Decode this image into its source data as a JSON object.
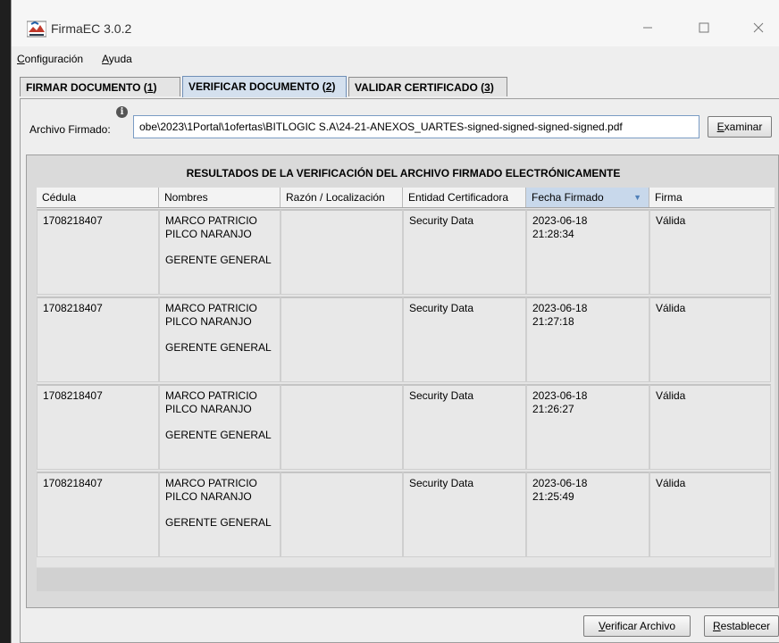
{
  "window": {
    "title": "FirmaEC 3.0.2"
  },
  "menu": {
    "configuracion_mnemonic": "C",
    "configuracion_rest": "onfiguración",
    "ayuda_mnemonic": "A",
    "ayuda_rest": "yuda"
  },
  "tabs": [
    {
      "label": "FIRMAR DOCUMENTO",
      "num": "1",
      "active": false
    },
    {
      "label": "VERIFICAR DOCUMENTO",
      "num": "2",
      "active": true
    },
    {
      "label": "VALIDAR CERTIFICADO",
      "num": "3",
      "active": false
    }
  ],
  "file": {
    "label": "Archivo Firmado:",
    "value": "obe\\2023\\1Portal\\1ofertas\\BITLOGIC S.A\\24-21-ANEXOS_UARTES-signed-signed-signed-signed.pdf",
    "browse_mnemonic": "E",
    "browse_rest": "xaminar"
  },
  "results": {
    "title": "RESULTADOS DE LA VERIFICACIÓN DEL ARCHIVO FIRMADO ELECTRÓNICAMENTE",
    "columns": [
      "Cédula",
      "Nombres",
      "Razón / Localización",
      "Entidad Certificadora",
      "Fecha Firmado",
      "Firma"
    ],
    "rows": [
      {
        "cedula": "1708218407",
        "nombre": "MARCO PATRICIO PILCO NARANJO",
        "cargo": "GERENTE GENERAL",
        "razon": "",
        "entidad": "Security Data",
        "fecha": "2023-06-18",
        "hora": "21:28:34",
        "firma": "Válida"
      },
      {
        "cedula": "1708218407",
        "nombre": "MARCO PATRICIO PILCO NARANJO",
        "cargo": "GERENTE GENERAL",
        "razon": "",
        "entidad": "Security Data",
        "fecha": "2023-06-18",
        "hora": "21:27:18",
        "firma": "Válida"
      },
      {
        "cedula": "1708218407",
        "nombre": "MARCO PATRICIO PILCO NARANJO",
        "cargo": "GERENTE GENERAL",
        "razon": "",
        "entidad": "Security Data",
        "fecha": "2023-06-18",
        "hora": "21:26:27",
        "firma": "Válida"
      },
      {
        "cedula": "1708218407",
        "nombre": "MARCO PATRICIO PILCO NARANJO",
        "cargo": "GERENTE GENERAL",
        "razon": "",
        "entidad": "Security Data",
        "fecha": "2023-06-18",
        "hora": "21:25:49",
        "firma": "Válida"
      }
    ]
  },
  "actions": {
    "verify_mnemonic": "V",
    "verify_rest": "erificar Archivo",
    "reset_mnemonic": "R",
    "reset_rest": "establecer"
  },
  "icons": {
    "app": "firma-app-icon",
    "info": "info-icon",
    "sort": "sort-descending-icon",
    "minimize": "minimize-icon",
    "maximize": "maximize-icon",
    "close": "close-icon"
  },
  "colors": {
    "active_tab": "#d4e0ee",
    "sorted_header": "#c8d8eb"
  }
}
